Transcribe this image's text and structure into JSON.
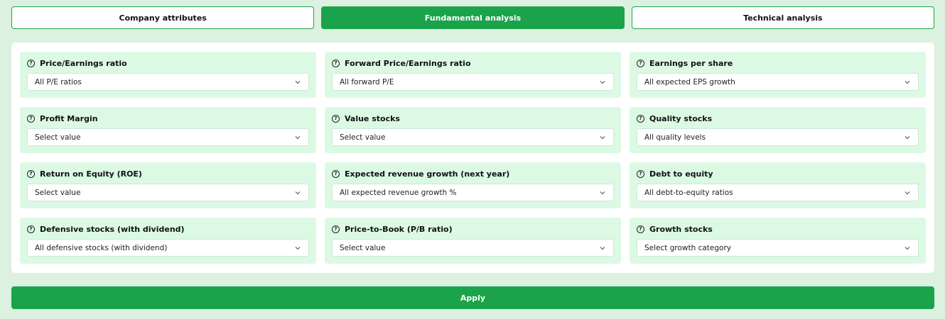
{
  "tabs": [
    {
      "label": "Company attributes",
      "active": false
    },
    {
      "label": "Fundamental analysis",
      "active": true
    },
    {
      "label": "Technical analysis",
      "active": false
    }
  ],
  "filters": [
    {
      "label": "Price/Earnings ratio",
      "value": "All P/E ratios"
    },
    {
      "label": "Forward Price/Earnings ratio",
      "value": "All forward P/E"
    },
    {
      "label": "Earnings per share",
      "value": "All expected EPS growth"
    },
    {
      "label": "Profit Margin",
      "value": "Select value"
    },
    {
      "label": "Value stocks",
      "value": "Select value"
    },
    {
      "label": "Quality stocks",
      "value": "All quality levels"
    },
    {
      "label": "Return on Equity (ROE)",
      "value": "Select value"
    },
    {
      "label": "Expected revenue growth (next year)",
      "value": "All expected revenue growth %"
    },
    {
      "label": "Debt to equity",
      "value": "All debt-to-equity ratios"
    },
    {
      "label": "Defensive stocks (with dividend)",
      "value": "All defensive stocks (with dividend)"
    },
    {
      "label": "Price-to-Book (P/B ratio)",
      "value": "Select value"
    },
    {
      "label": "Growth stocks",
      "value": "Select growth category"
    }
  ],
  "help_glyph": "?",
  "apply_label": "Apply",
  "colors": {
    "accent": "#1aa34a",
    "card_bg": "#dcf9e4",
    "page_bg": "#ddf1e0"
  }
}
